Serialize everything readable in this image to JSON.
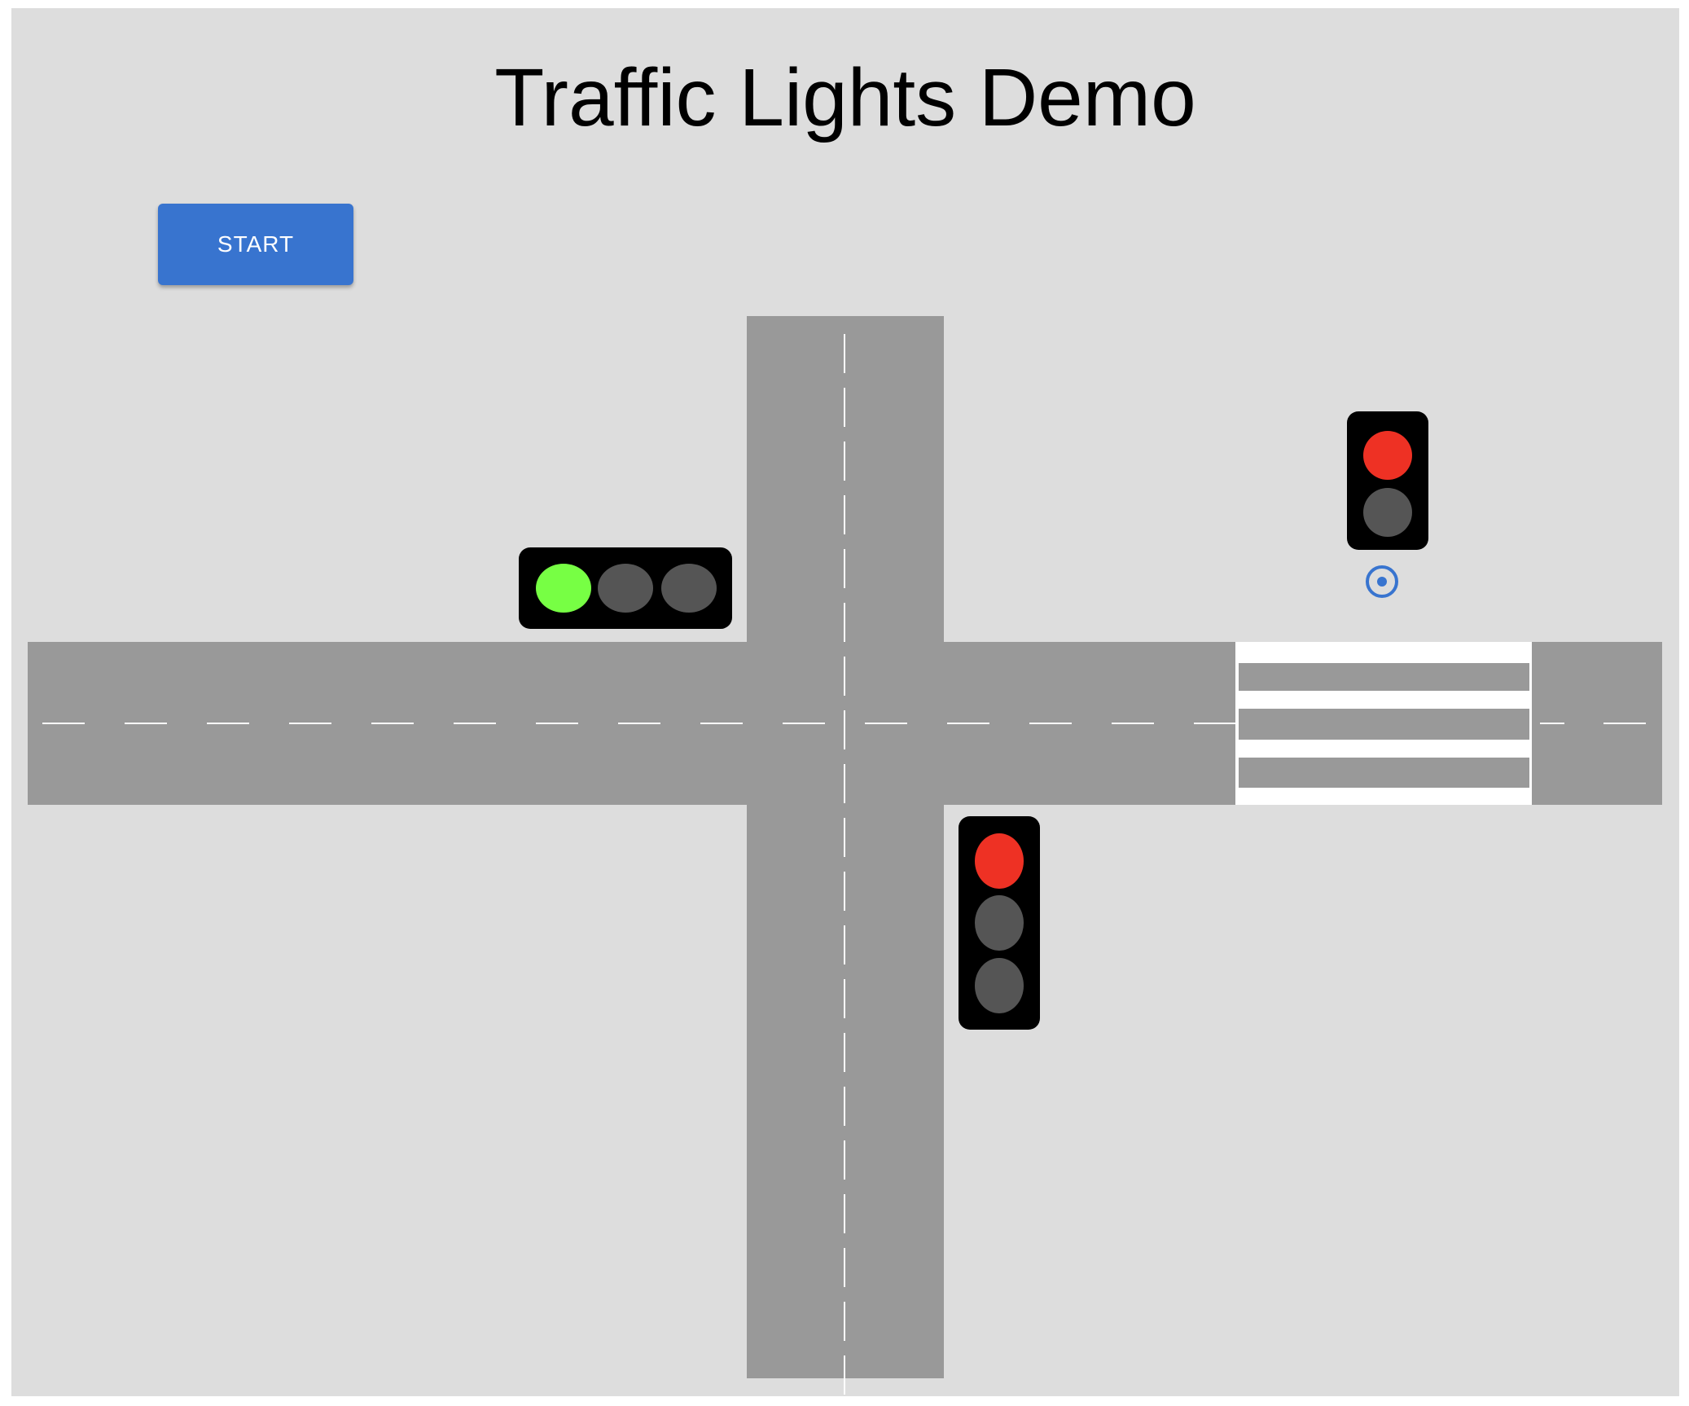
{
  "app": {
    "title": "Traffic Lights Demo",
    "start_label": "START"
  },
  "lights": {
    "horizontal_road_light": {
      "orientation": "horizontal",
      "lamps": [
        "green",
        "off",
        "off"
      ]
    },
    "vertical_road_light": {
      "orientation": "vertical",
      "lamps": [
        "red",
        "off",
        "off"
      ]
    },
    "pedestrian_light": {
      "orientation": "vertical",
      "lamps": [
        "red",
        "off"
      ]
    }
  },
  "icons": {
    "pedestrian_button": "radio-target-icon"
  },
  "colors": {
    "background": "#dddddd",
    "road": "#999999",
    "lane_marking": "#ffffff",
    "crosswalk_stripe": "#ffffff",
    "light_housing": "#000000",
    "lamp_red": "#ee3124",
    "lamp_green": "#77ff44",
    "lamp_off": "#555555",
    "button_primary": "#3874cf",
    "button_text": "#ffffff",
    "pedestrian_button": "#3874cf"
  }
}
